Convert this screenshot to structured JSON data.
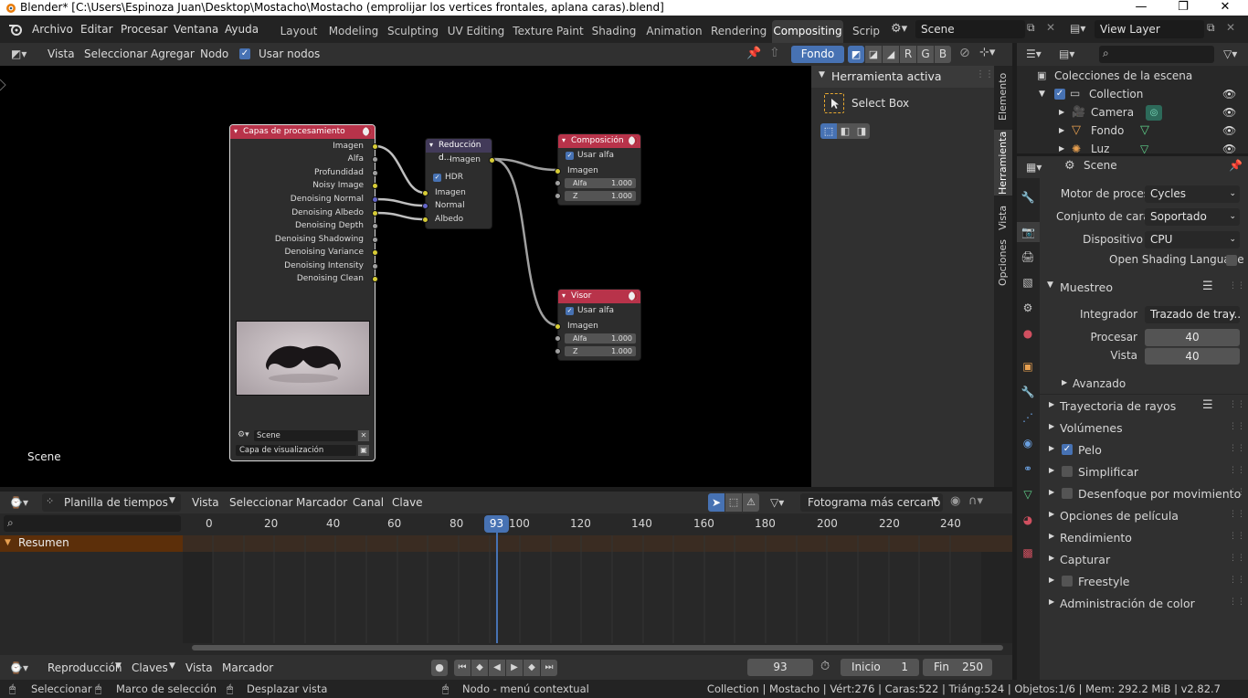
{
  "titlebar": {
    "title": "Blender* [C:\\Users\\Espinoza Juan\\Desktop\\Mostacho\\Mostacho (emprolijar los vertices frontales, aplana caras).blend]",
    "minimize": "—",
    "maximize": "❐",
    "close": "✕"
  },
  "menu": [
    "Archivo",
    "Editar",
    "Procesar",
    "Ventana",
    "Ayuda"
  ],
  "workspaces": [
    "Layout",
    "Modeling",
    "Sculpting",
    "UV Editing",
    "Texture Paint",
    "Shading",
    "Animation",
    "Rendering",
    "Compositing",
    "Scrip"
  ],
  "active_workspace": "Compositing",
  "scene_field": "Scene",
  "viewlayer_field": "View Layer",
  "node_header": {
    "menus": [
      "Vista",
      "Seleccionar",
      "Agregar",
      "Nodo"
    ],
    "use_nodes_label": "Usar nodos",
    "backdrop_label": "Fondo",
    "channels": [
      "R",
      "G",
      "B"
    ]
  },
  "nodes": {
    "render_layers": {
      "title": "Capas de procesamiento",
      "outputs": [
        "Imagen",
        "Alfa",
        "Profundidad",
        "Noisy Image",
        "Denoising Normal",
        "Denoising Albedo",
        "Denoising Depth",
        "Denoising Shadowing",
        "Denoising Variance",
        "Denoising Intensity",
        "Denoising Clean"
      ],
      "scene": "Scene",
      "layer": "Capa de visualización"
    },
    "denoise": {
      "title": "Reducción d...",
      "output": "Imagen",
      "hdr_label": "HDR",
      "inputs": [
        "Imagen",
        "Normal",
        "Albedo"
      ]
    },
    "composite": {
      "title": "Composición",
      "use_alpha": "Usar alfa",
      "input": "Imagen",
      "alpha_label": "Alfa",
      "alpha_value": "1.000",
      "z_label": "Z",
      "z_value": "1.000"
    },
    "viewer": {
      "title": "Visor",
      "use_alpha": "Usar alfa",
      "input": "Imagen",
      "alpha_label": "Alfa",
      "alpha_value": "1.000",
      "z_label": "Z",
      "z_value": "1.000"
    }
  },
  "editor_scene_label": "Scene",
  "npanel": {
    "section": "Herramienta activa",
    "tool": "Select Box",
    "tabs": [
      "Elemento",
      "Herramienta",
      "Vista",
      "Opciones"
    ]
  },
  "timeline": {
    "editor": "Planilla de tiempos",
    "menus": [
      "Vista",
      "Seleccionar",
      "Marcador",
      "Canal",
      "Clave"
    ],
    "snap": "Fotograma más cercano",
    "ticks": [
      "0",
      "20",
      "40",
      "60",
      "80",
      "100",
      "120",
      "140",
      "160",
      "180",
      "200",
      "220",
      "240"
    ],
    "current_frame": "93",
    "summary": "Resumen"
  },
  "playback": {
    "playback": "Reproducción",
    "keys": "Claves",
    "vista": "Vista",
    "marker": "Marcador",
    "frame": "93",
    "start_label": "Inicio",
    "start": "1",
    "end_label": "Fin",
    "end": "250"
  },
  "outliner": {
    "title": "Colecciones de la escena",
    "items": [
      "Collection",
      "Camera",
      "Fondo",
      "Luz"
    ]
  },
  "properties": {
    "scene": "Scene",
    "engine_label": "Motor de procesa..",
    "engine": "Cycles",
    "feature_label": "Conjunto de carac..",
    "feature": "Soportado",
    "device_label": "Dispositivo",
    "device": "CPU",
    "osl": "Open Shading Language",
    "sampling": "Muestreo",
    "integrator_label": "Integrador",
    "integrator": "Trazado de tray...",
    "render_label": "Procesar",
    "render": "40",
    "viewport_label": "Vista",
    "viewport": "40",
    "advanced": "Avanzado",
    "sections": [
      "Trayectoria de rayos",
      "Volúmenes",
      "Pelo",
      "Simplificar",
      "Desenfoque por movimiento",
      "Opciones de película",
      "Rendimiento",
      "Capturar",
      "Freestyle",
      "Administración de color"
    ]
  },
  "status": {
    "select": "Seleccionar",
    "box": "Marco de selección",
    "pan": "Desplazar vista",
    "context": "Nodo - menú contextual",
    "stats": "Collection | Mostacho | Vért:276 | Caras:522 | Triáng:524 | Objetos:1/6 | Mem: 292.2 MiB | v2.82.7"
  },
  "colors": {
    "accent": "#4772b3",
    "node_red": "#b8334a",
    "node_purple": "#423a59",
    "socket_yellow": "#d7cc36",
    "playhead": "#4772b3"
  }
}
